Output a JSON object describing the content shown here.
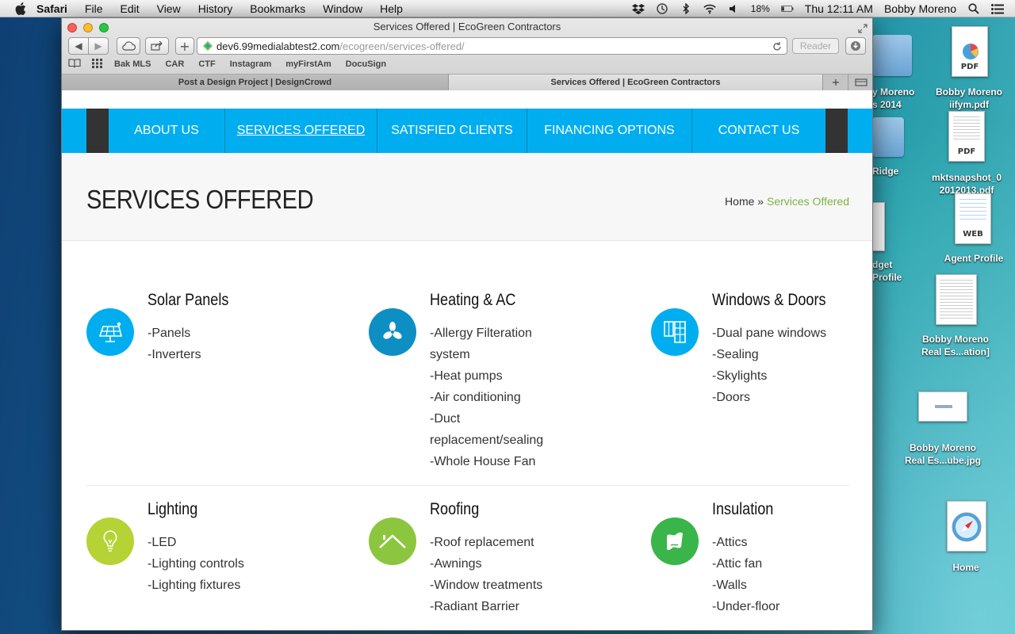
{
  "menubar": {
    "app": "Safari",
    "menus": [
      "File",
      "Edit",
      "View",
      "History",
      "Bookmarks",
      "Window",
      "Help"
    ],
    "battery": "18%",
    "clock": "Thu 12:11 AM",
    "user": "Bobby Moreno"
  },
  "desktop": {
    "icons": [
      {
        "label1": "y Moreno",
        "label2": "s 2014"
      },
      {
        "label1": "Bobby Moreno",
        "label2": "iifym.pdf",
        "tag": "PDF"
      },
      {
        "label1": "Ridge",
        "label2": ""
      },
      {
        "label1": "mktsnapshot_0",
        "label2": "2012013.pdf",
        "tag": "PDF"
      },
      {
        "label1": "Agent Profile",
        "label2": "",
        "tag": "WEB"
      },
      {
        "label1": "dget",
        "label2": "Profile"
      },
      {
        "label1": "Bobby Moreno",
        "label2": "Real Es...ation]"
      },
      {
        "label1": "Bobby Moreno",
        "label2": "Real Es...ube.jpg"
      },
      {
        "label1": "Home",
        "label2": ""
      }
    ]
  },
  "browser": {
    "window_title": "Services Offered | EcoGreen Contractors",
    "url_host": "dev6.99medialabtest2.com",
    "url_path": "/ecogreen/services-offered/",
    "reader_label": "Reader",
    "bookmarks": [
      "Bak MLS",
      "CAR",
      "CTF",
      "Instagram",
      "myFirstAm",
      "DocuSign"
    ],
    "tabs": [
      {
        "label": "Post a Design Project | DesignCrowd"
      },
      {
        "label": "Services Offered | EcoGreen Contractors"
      }
    ]
  },
  "site": {
    "nav": [
      "ABOUT US",
      "SERVICES OFFERED",
      "SATISFIED CLIENTS",
      "FINANCING OPTIONS",
      "CONTACT US"
    ],
    "page_title": "SERVICES OFFERED",
    "breadcrumb": {
      "home": "Home",
      "sep": "»",
      "current": "Services Offered"
    },
    "services": [
      {
        "title": "Solar Panels",
        "icon": "solar-panel-icon",
        "color": "#00aeef",
        "items": [
          "-Panels",
          "-Inverters"
        ]
      },
      {
        "title": "Heating & AC",
        "icon": "fan-icon",
        "color": "#0e8fc4",
        "items": [
          "-Allergy Filteration system",
          "-Heat pumps",
          "-Air conditioning",
          "-Duct replacement/sealing",
          "-Whole House Fan"
        ]
      },
      {
        "title": "Windows & Doors",
        "icon": "window-door-icon",
        "color": "#00aeef",
        "items": [
          "-Dual pane windows",
          "-Sealing",
          "-Skylights",
          "-Doors"
        ]
      },
      {
        "title": "Lighting",
        "icon": "light-bulb-icon",
        "color": "#b5d334",
        "items": [
          "-LED",
          "-Lighting controls",
          "-Lighting fixtures"
        ]
      },
      {
        "title": "Roofing",
        "icon": "roof-icon",
        "color": "#8cc63f",
        "items": [
          "-Roof replacement",
          "-Awnings",
          "-Window treatments",
          "-Radiant Barrier"
        ]
      },
      {
        "title": "Insulation",
        "icon": "insulation-icon",
        "color": "#39b54a",
        "items": [
          "-Attics",
          "-Attic fan",
          "-Walls",
          "-Under-floor"
        ]
      }
    ]
  }
}
